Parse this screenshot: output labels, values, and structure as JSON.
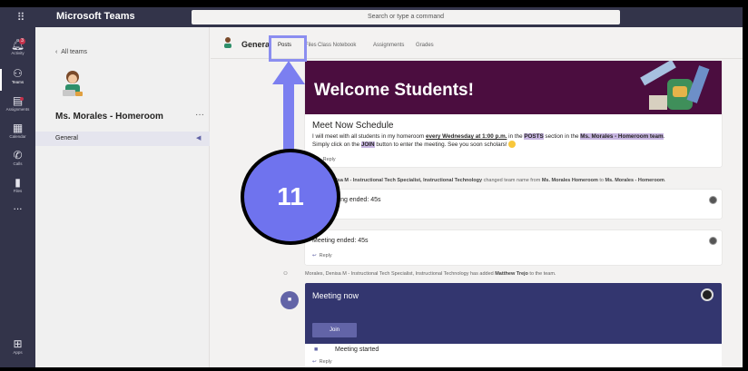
{
  "titlebar": {
    "app_name": "Microsoft Teams",
    "search_placeholder": "Search or type a command"
  },
  "rail": {
    "items": [
      {
        "label": "Activity",
        "badge": "3"
      },
      {
        "label": "Teams"
      },
      {
        "label": "Assignments"
      },
      {
        "label": "Calendar"
      },
      {
        "label": "Calls"
      },
      {
        "label": "Files"
      },
      {
        "label": "..."
      },
      {
        "label": "Apps"
      }
    ]
  },
  "team": {
    "back_label": "All teams",
    "name": "Ms. Morales - Homeroom",
    "more": "···",
    "channel": "General"
  },
  "channel_header": {
    "title": "General",
    "tabs": [
      "Posts",
      "Files",
      "Class Notebook",
      "Assignments",
      "Grades"
    ]
  },
  "feed": {
    "banner_title": "Welcome Students!",
    "post_title": "Meet Now Schedule",
    "post_body": {
      "p1": "I will meet with all students in my homeroom ",
      "p2": "every Wednesday at 1:00 p.m.",
      "p3": " in the ",
      "p4": "POSTS",
      "p5": " section in the ",
      "p6": "Ms. Morales - Homeroom team",
      "p7": ".",
      "p8": "Simply click on the ",
      "p9": "JOIN",
      "p10": " button to enter the meeting.  See you soon scholars! "
    },
    "reply_label": "Reply",
    "sys1": {
      "actor": "Morales, Denisa M - Instructional Tech Specialist, Instructional Technology",
      "text": " changed team name from ",
      "from": "Ms. Morales Homeroom",
      "mid": " to ",
      "to": "Ms. Morales - Homeroom",
      "end": "."
    },
    "meeting_ended_1": "Meeting ended: 45s",
    "meeting_ended_2": "Meeting ended: 45s",
    "sys2": {
      "actor": "Morales, Denisa M - Instructional Tech Specialist, Instructional Technology",
      "text": " has added ",
      "who": "Matthew Trejo",
      "end": " to the team."
    },
    "meet_now_title": "Meeting now",
    "join_label": "Join",
    "meeting_started": "Meeting started"
  },
  "annotation": {
    "step_number": "11"
  },
  "colors": {
    "rail": "#33344a",
    "accent": "#6264a7",
    "banner": "#4b0d3f",
    "meet_now": "#33366f",
    "callout": "#6f73ee"
  }
}
